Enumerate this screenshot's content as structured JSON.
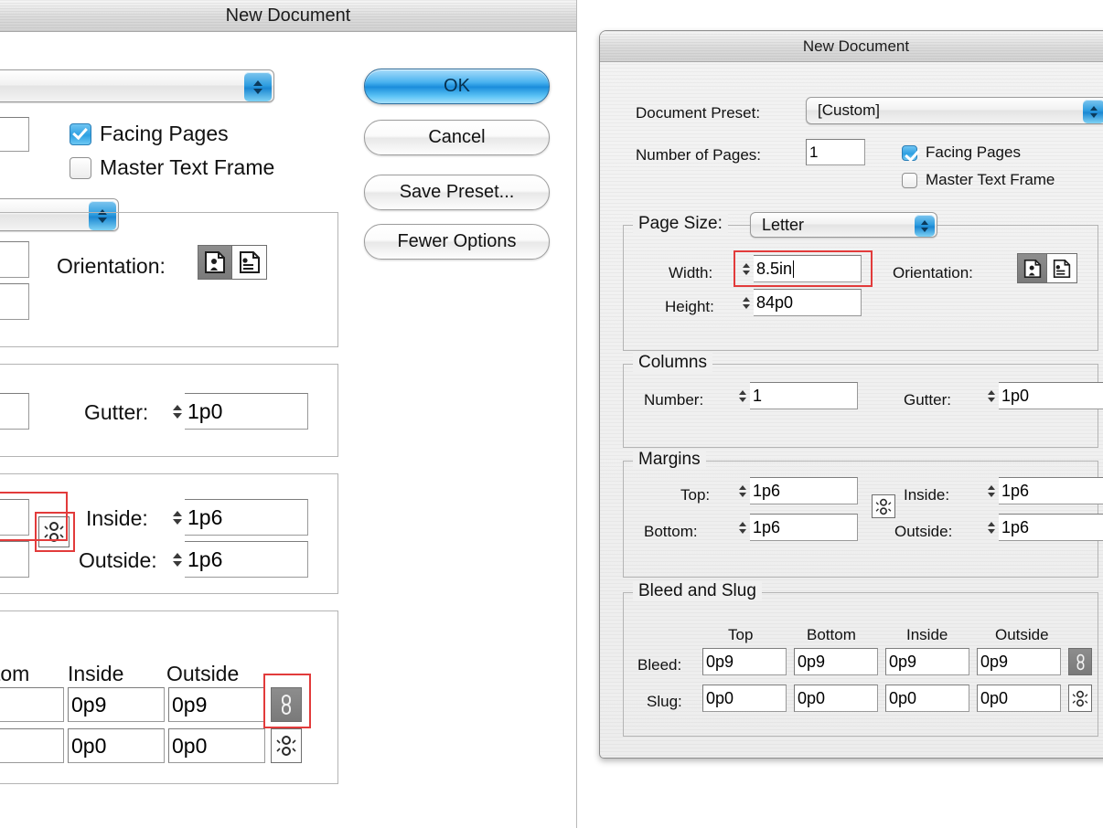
{
  "dialog": {
    "title": "New Document",
    "document_preset": {
      "label": "Document Preset:",
      "value": "[Custom]"
    },
    "number_of_pages": {
      "label": "Number of Pages:",
      "value": "1"
    },
    "facing_pages": {
      "label": "Facing Pages",
      "checked": true
    },
    "master_text_frame": {
      "label": "Master Text Frame",
      "checked": false
    },
    "page_size": {
      "group_label": "Page Size:",
      "value": "Letter",
      "width": {
        "label": "Width:",
        "value": "8.5in"
      },
      "height": {
        "label": "Height:",
        "value": "84p0"
      },
      "orientation": {
        "label": "Orientation:",
        "portrait_icon": "portrait-page-icon",
        "landscape_icon": "landscape-page-icon",
        "selected": "portrait"
      }
    },
    "columns": {
      "group_label": "Columns",
      "number": {
        "label": "Number:",
        "value": "1"
      },
      "gutter": {
        "label": "Gutter:",
        "value": "1p0"
      }
    },
    "margins": {
      "group_label": "Margins",
      "top": {
        "label": "Top:",
        "value": "1p6"
      },
      "bottom": {
        "label": "Bottom:",
        "value": "1p6"
      },
      "inside": {
        "label": "Inside:",
        "value": "1p6"
      },
      "outside": {
        "label": "Outside:",
        "value": "1p6"
      },
      "link_icon": "broken-link-icon",
      "linked": false
    },
    "bleed_and_slug": {
      "group_label": "Bleed and Slug",
      "columns": [
        "Top",
        "Bottom",
        "Inside",
        "Outside"
      ],
      "rows": [
        {
          "label": "Bleed:",
          "values": [
            "0p9",
            "0p9",
            "0p9",
            "0p9"
          ],
          "link_icon": "link-icon",
          "linked": true
        },
        {
          "label": "Slug:",
          "values": [
            "0p0",
            "0p0",
            "0p0",
            "0p0"
          ],
          "link_icon": "broken-link-icon",
          "linked": false
        }
      ]
    },
    "buttons": {
      "ok": "OK",
      "cancel": "Cancel",
      "save_preset": "Save Preset...",
      "fewer_options": "Fewer Options"
    }
  },
  "colors": {
    "accent_blue": "#1b8ddc",
    "annotation_red": "#e23b3b",
    "dialog_bg": "#f0f0f0",
    "field_bg": "#ffffff"
  }
}
